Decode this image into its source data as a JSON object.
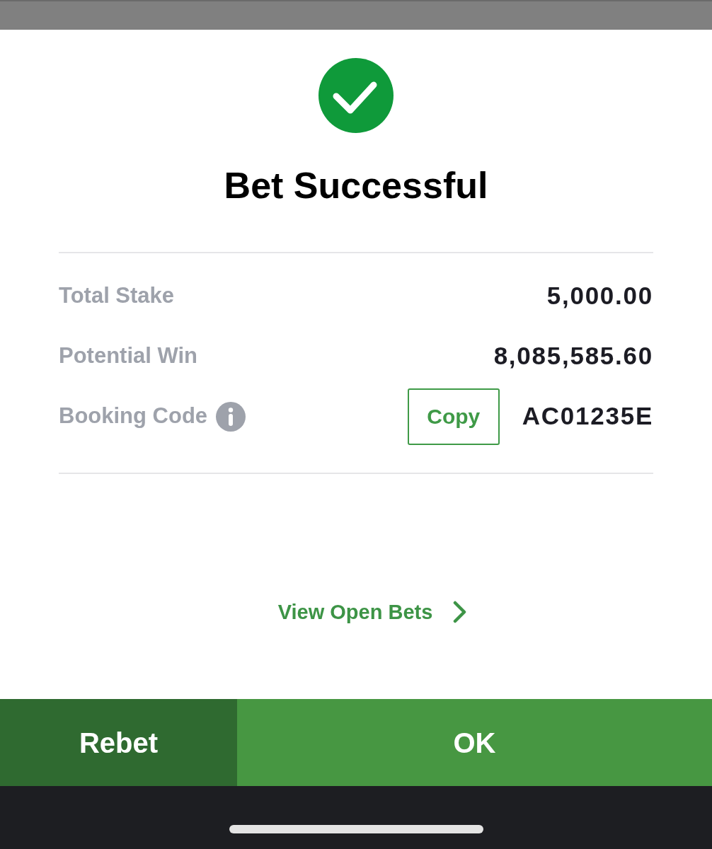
{
  "status": {
    "title": "Bet Successful"
  },
  "summary": {
    "rows": [
      {
        "kind": "amount",
        "label": "Total Stake",
        "value": "5,000.00"
      },
      {
        "kind": "amount",
        "label": "Potential Win",
        "value": "8,085,585.60"
      },
      {
        "kind": "code",
        "label": "Booking Code",
        "copy_button": "Copy",
        "value": "AC01235E"
      }
    ]
  },
  "link": {
    "label": "View Open Bets"
  },
  "actions": [
    {
      "kind": "secondary",
      "label": "Rebet"
    },
    {
      "kind": "primary",
      "label": "OK"
    }
  ]
}
